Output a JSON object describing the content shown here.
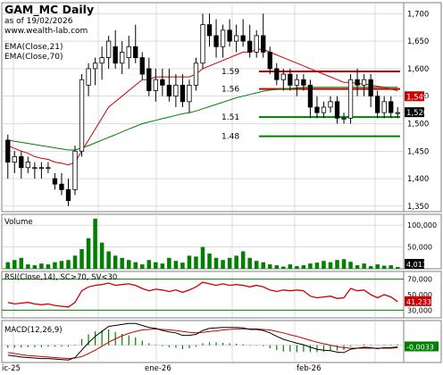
{
  "chart_data": {
    "type": "candlestick",
    "title": "GAM_MC Daily",
    "subtitle": "as of 19/02/2026",
    "source": "www.wealth-lab.com",
    "indicators_main": [
      "EMA(Close,21)",
      "EMA(Close,70)"
    ],
    "x_tick_labels": [
      "ic-25",
      "ene-26",
      "feb-26"
    ],
    "price_axis": {
      "ticks": [
        "1,350",
        "1,400",
        "1,450",
        "1,500",
        "1,550",
        "1,600",
        "1,650",
        "1,700"
      ],
      "range": [
        1.34,
        1.72
      ]
    },
    "last_price": "1,520",
    "last_price_2": "1,549",
    "levels": [
      {
        "label": "1.59",
        "value": 1.595,
        "color": "#cc0000"
      },
      {
        "label": "1.56",
        "value": 1.563,
        "color": "#cc0000"
      },
      {
        "label": "1.51",
        "value": 1.512,
        "color": "#008000"
      },
      {
        "label": "1.48",
        "value": 1.477,
        "color": "#008000"
      }
    ],
    "candles": [
      [
        1.47,
        1.48,
        1.4,
        1.43
      ],
      [
        1.43,
        1.45,
        1.41,
        1.44
      ],
      [
        1.44,
        1.45,
        1.4,
        1.42
      ],
      [
        1.42,
        1.44,
        1.41,
        1.43
      ],
      [
        1.42,
        1.43,
        1.4,
        1.42
      ],
      [
        1.42,
        1.43,
        1.4,
        1.42
      ],
      [
        1.42,
        1.43,
        1.41,
        1.42
      ],
      [
        1.4,
        1.41,
        1.38,
        1.39
      ],
      [
        1.39,
        1.41,
        1.37,
        1.38
      ],
      [
        1.38,
        1.4,
        1.35,
        1.36
      ],
      [
        1.38,
        1.46,
        1.37,
        1.45
      ],
      [
        1.45,
        1.59,
        1.44,
        1.58
      ],
      [
        1.57,
        1.61,
        1.55,
        1.6
      ],
      [
        1.6,
        1.62,
        1.57,
        1.61
      ],
      [
        1.61,
        1.64,
        1.58,
        1.62
      ],
      [
        1.62,
        1.66,
        1.6,
        1.65
      ],
      [
        1.64,
        1.67,
        1.6,
        1.61
      ],
      [
        1.61,
        1.65,
        1.59,
        1.63
      ],
      [
        1.62,
        1.66,
        1.6,
        1.64
      ],
      [
        1.64,
        1.68,
        1.61,
        1.62
      ],
      [
        1.62,
        1.63,
        1.58,
        1.59
      ],
      [
        1.6,
        1.62,
        1.55,
        1.56
      ],
      [
        1.56,
        1.6,
        1.54,
        1.58
      ],
      [
        1.58,
        1.6,
        1.55,
        1.57
      ],
      [
        1.57,
        1.6,
        1.54,
        1.55
      ],
      [
        1.55,
        1.59,
        1.53,
        1.57
      ],
      [
        1.57,
        1.59,
        1.53,
        1.54
      ],
      [
        1.54,
        1.58,
        1.52,
        1.57
      ],
      [
        1.57,
        1.62,
        1.56,
        1.61
      ],
      [
        1.61,
        1.7,
        1.6,
        1.68
      ],
      [
        1.68,
        1.7,
        1.64,
        1.66
      ],
      [
        1.66,
        1.69,
        1.62,
        1.64
      ],
      [
        1.64,
        1.68,
        1.62,
        1.67
      ],
      [
        1.67,
        1.69,
        1.64,
        1.65
      ],
      [
        1.65,
        1.68,
        1.63,
        1.66
      ],
      [
        1.66,
        1.69,
        1.64,
        1.65
      ],
      [
        1.65,
        1.68,
        1.62,
        1.63
      ],
      [
        1.63,
        1.67,
        1.62,
        1.66
      ],
      [
        1.66,
        1.7,
        1.62,
        1.63
      ],
      [
        1.63,
        1.64,
        1.59,
        1.6
      ],
      [
        1.6,
        1.61,
        1.57,
        1.58
      ],
      [
        1.58,
        1.6,
        1.56,
        1.59
      ],
      [
        1.59,
        1.6,
        1.56,
        1.57
      ],
      [
        1.57,
        1.59,
        1.55,
        1.58
      ],
      [
        1.58,
        1.59,
        1.56,
        1.57
      ],
      [
        1.57,
        1.58,
        1.51,
        1.53
      ],
      [
        1.53,
        1.55,
        1.51,
        1.52
      ],
      [
        1.52,
        1.54,
        1.51,
        1.53
      ],
      [
        1.53,
        1.55,
        1.52,
        1.54
      ],
      [
        1.54,
        1.55,
        1.5,
        1.51
      ],
      [
        1.51,
        1.52,
        1.5,
        1.51
      ],
      [
        1.51,
        1.59,
        1.5,
        1.58
      ],
      [
        1.58,
        1.6,
        1.55,
        1.57
      ],
      [
        1.57,
        1.59,
        1.55,
        1.58
      ],
      [
        1.58,
        1.59,
        1.53,
        1.55
      ],
      [
        1.55,
        1.56,
        1.51,
        1.52
      ],
      [
        1.52,
        1.55,
        1.51,
        1.54
      ],
      [
        1.54,
        1.55,
        1.51,
        1.52
      ],
      [
        1.52,
        1.53,
        1.51,
        1.52
      ]
    ],
    "ema21": [
      1.46,
      1.455,
      1.45,
      1.446,
      1.44,
      1.437,
      1.435,
      1.43,
      1.428,
      1.425,
      1.43,
      1.45,
      1.47,
      1.49,
      1.51,
      1.53,
      1.54,
      1.55,
      1.56,
      1.57,
      1.58,
      1.58,
      1.585,
      1.585,
      1.585,
      1.585,
      1.585,
      1.585,
      1.59,
      1.6,
      1.605,
      1.61,
      1.615,
      1.62,
      1.625,
      1.63,
      1.63,
      1.635,
      1.635,
      1.63,
      1.625,
      1.62,
      1.615,
      1.61,
      1.605,
      1.6,
      1.595,
      1.59,
      1.585,
      1.58,
      1.575,
      1.575,
      1.573,
      1.572,
      1.57,
      1.568,
      1.566,
      1.563,
      1.56
    ],
    "ema70": [
      1.47,
      1.468,
      1.466,
      1.464,
      1.462,
      1.46,
      1.458,
      1.456,
      1.454,
      1.452,
      1.452,
      1.456,
      1.46,
      1.465,
      1.47,
      1.475,
      1.48,
      1.485,
      1.49,
      1.495,
      1.5,
      1.503,
      1.506,
      1.509,
      1.512,
      1.515,
      1.518,
      1.52,
      1.523,
      1.527,
      1.531,
      1.535,
      1.539,
      1.543,
      1.547,
      1.55,
      1.553,
      1.556,
      1.559,
      1.561,
      1.562,
      1.563,
      1.564,
      1.565,
      1.566,
      1.566,
      1.566,
      1.566,
      1.566,
      1.566,
      1.566,
      1.566,
      1.566,
      1.566,
      1.566,
      1.566,
      1.566,
      1.566,
      1.566
    ],
    "volume": {
      "label": "Volume",
      "ticks": [
        "100,000",
        "50,000"
      ],
      "last": "4,011",
      "max": 125000,
      "values": [
        15000,
        20000,
        25000,
        10000,
        8000,
        12000,
        10000,
        15000,
        18000,
        20000,
        30000,
        45000,
        70000,
        115000,
        60000,
        40000,
        30000,
        25000,
        20000,
        15000,
        10000,
        20000,
        15000,
        12000,
        25000,
        18000,
        14000,
        30000,
        28000,
        50000,
        35000,
        25000,
        20000,
        25000,
        30000,
        40000,
        25000,
        18000,
        15000,
        10000,
        8000,
        5000,
        10000,
        6000,
        8000,
        12000,
        14000,
        18000,
        15000,
        20000,
        22000,
        16000,
        8000,
        12000,
        6000,
        10000,
        7000,
        8000,
        4011
      ]
    },
    "rsi": {
      "label": "RSI(Close,14), SC>70, SV<30",
      "ticks": [
        "70,000",
        "50,000",
        "30,000"
      ],
      "last": "41,233",
      "values": [
        40,
        38,
        39,
        40,
        38,
        37,
        38,
        36,
        35,
        34,
        40,
        55,
        60,
        62,
        63,
        65,
        62,
        63,
        64,
        62,
        58,
        55,
        57,
        56,
        54,
        56,
        53,
        56,
        60,
        66,
        64,
        62,
        64,
        62,
        63,
        62,
        60,
        62,
        60,
        56,
        54,
        56,
        55,
        56,
        55,
        48,
        46,
        47,
        48,
        45,
        46,
        58,
        55,
        56,
        50,
        46,
        50,
        47,
        41
      ]
    },
    "macd": {
      "label": "MACD(12,26,9)",
      "last": "-0,0033",
      "values": [
        -0.02,
        -0.022,
        -0.024,
        -0.025,
        -0.026,
        -0.027,
        -0.027,
        -0.028,
        -0.029,
        -0.03,
        -0.025,
        -0.01,
        0.005,
        0.018,
        0.028,
        0.038,
        0.04,
        0.042,
        0.044,
        0.044,
        0.04,
        0.036,
        0.034,
        0.03,
        0.027,
        0.025,
        0.02,
        0.02,
        0.022,
        0.03,
        0.034,
        0.035,
        0.036,
        0.036,
        0.036,
        0.035,
        0.032,
        0.032,
        0.03,
        0.025,
        0.018,
        0.012,
        0.008,
        0.004,
        0.001,
        -0.004,
        -0.008,
        -0.01,
        -0.011,
        -0.014,
        -0.015,
        -0.008,
        -0.006,
        -0.004,
        -0.005,
        -0.007,
        -0.005,
        -0.005,
        -0.0033
      ],
      "signal": [
        -0.015,
        -0.017,
        -0.019,
        -0.021,
        -0.022,
        -0.023,
        -0.024,
        -0.025,
        -0.026,
        -0.027,
        -0.026,
        -0.023,
        -0.017,
        -0.01,
        -0.002,
        0.006,
        0.013,
        0.019,
        0.024,
        0.028,
        0.031,
        0.032,
        0.033,
        0.032,
        0.031,
        0.03,
        0.028,
        0.026,
        0.025,
        0.026,
        0.028,
        0.029,
        0.031,
        0.032,
        0.033,
        0.033,
        0.033,
        0.033,
        0.032,
        0.031,
        0.028,
        0.025,
        0.021,
        0.018,
        0.014,
        0.01,
        0.006,
        0.003,
        0.0,
        -0.003,
        -0.005,
        -0.006,
        -0.006,
        -0.006,
        -0.006,
        -0.006,
        -0.006,
        -0.006,
        -0.005
      ]
    }
  },
  "colors": {
    "up": "#ffffff",
    "down": "#000000",
    "ema21": "#cc0000",
    "ema70": "#008000",
    "volume": "#008000",
    "rsi": "#cc0000",
    "macd": "#000000",
    "signal": "#cc0000",
    "hist": "#008000",
    "grid": "#c8c8c8",
    "band": "#008000"
  }
}
